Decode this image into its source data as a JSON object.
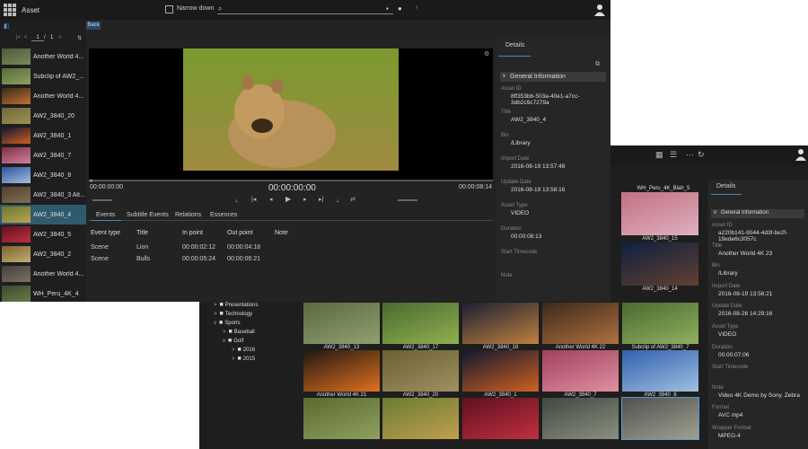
{
  "app_title": "Asset",
  "toolbar": {
    "narrow_down_label": "Narrow down"
  },
  "pager": {
    "first": "|<",
    "prev": "<",
    "page": "1",
    "of": "/",
    "total": "1",
    "next": ">",
    "sort": "⇅"
  },
  "back_label": "Back",
  "asset_list": [
    {
      "label": "Another World 4...",
      "c1": "#4a5a3a",
      "c2": "#7a8a5a"
    },
    {
      "label": "Subclip of AW2_...",
      "c1": "#556b3a",
      "c2": "#90a060"
    },
    {
      "label": "Another World 4...",
      "c1": "#3a2a1a",
      "c2": "#c07030"
    },
    {
      "label": "AW2_3840_20",
      "c1": "#6a6a3a",
      "c2": "#a09050"
    },
    {
      "label": "AW2_3840_1",
      "c1": "#101830",
      "c2": "#d06020"
    },
    {
      "label": "AW2_3840_7",
      "c1": "#803040",
      "c2": "#d080a0"
    },
    {
      "label": "AW2_3840_8",
      "c1": "#3050a0",
      "c2": "#a0c0e0"
    },
    {
      "label": "AW2_3840_3 Alt...",
      "c1": "#504030",
      "c2": "#807050"
    },
    {
      "label": "AW2_3840_4",
      "c1": "#6a7a30",
      "c2": "#c0a050"
    },
    {
      "label": "AW2_3840_5",
      "c1": "#601020",
      "c2": "#c03040"
    },
    {
      "label": "AW2_3840_2",
      "c1": "#806030",
      "c2": "#c0b070"
    },
    {
      "label": "Another World 4...",
      "c1": "#404040",
      "c2": "#807060"
    },
    {
      "label": "WH_Peru_4K_4",
      "c1": "#3a4a2a",
      "c2": "#6a7a4a"
    }
  ],
  "player": {
    "time_left": "00:00:00:00",
    "time_center": "00:00:00:00",
    "time_right": "00:00:08:14"
  },
  "tabs": [
    "Events",
    "Subtitle Events",
    "Relations",
    "Essences"
  ],
  "events_table": {
    "headers": [
      "Event type",
      "Title",
      "In point",
      "Out point",
      "Note"
    ],
    "rows": [
      [
        "Scene",
        "Lion",
        "00:00:02:12",
        "00:00:04:18",
        ""
      ],
      [
        "Scene",
        "Bulls",
        "00:00:05:24",
        "00:00:06:21",
        ""
      ]
    ]
  },
  "details_front": {
    "tab": "Details",
    "section": "General Information",
    "fields": [
      {
        "label": "Asset ID",
        "value": "8ff353bb-503a-40e1-a7cc-3db2c9c7279a"
      },
      {
        "label": "Title",
        "value": "AW2_3840_4"
      },
      {
        "label": "Bin",
        "value": "/Library"
      },
      {
        "label": "Import Date",
        "value": "2016-08-19 13:57:48"
      },
      {
        "label": "Update Date",
        "value": "2016-08-19 13:58:16"
      },
      {
        "label": "Asset Type",
        "value": "VIDEO"
      },
      {
        "label": "Duration",
        "value": "00:00:08:13"
      },
      {
        "label": "Start Timecode",
        "value": ""
      },
      {
        "label": "Note",
        "value": ""
      }
    ]
  },
  "details_back": {
    "tab": "Details",
    "section": "General Information",
    "fields": [
      {
        "label": "Asset ID",
        "value": "a220b141-9044-4d3f-be2f-19ede6c3057c"
      },
      {
        "label": "Title",
        "value": "Another World 4K 23"
      },
      {
        "label": "Bin",
        "value": "/Library"
      },
      {
        "label": "Import Date",
        "value": "2016-08-19 13:56:21"
      },
      {
        "label": "Update Date",
        "value": "2016-08-26 14:29:16"
      },
      {
        "label": "Asset Type",
        "value": "VIDEO"
      },
      {
        "label": "Duration",
        "value": "00:00:07:06"
      },
      {
        "label": "Start Timecode",
        "value": ""
      },
      {
        "label": "Note",
        "value": "Video 4K Demo by Sony. Zebra"
      },
      {
        "label": "Format",
        "value": "AVC mp4"
      },
      {
        "label": "Wrapper Format",
        "value": "MPEG-4"
      }
    ]
  },
  "tree": [
    {
      "label": "Presentations",
      "indent": 0,
      "arrow": ">"
    },
    {
      "label": "Technology",
      "indent": 0,
      "arrow": ">"
    },
    {
      "label": "Sports",
      "indent": 0,
      "arrow": "v"
    },
    {
      "label": "Baseball",
      "indent": 1,
      "arrow": ">"
    },
    {
      "label": "Golf",
      "indent": 1,
      "arrow": "v"
    },
    {
      "label": "2016",
      "indent": 2,
      "arrow": ">"
    },
    {
      "label": "2015",
      "indent": 2,
      "arrow": ">"
    }
  ],
  "grid_right_col": [
    {
      "label": "AW2_3840_15",
      "c1": "#c07080",
      "c2": "#e0b0c0"
    },
    {
      "label": "AW2_3840_14",
      "c1": "#102040",
      "c2": "#604030"
    }
  ],
  "grid_partial_label": "WH_Peru_4K_Blah_5",
  "grid": [
    [
      {
        "label": "AW2_3840_13",
        "c1": "#5a6a40",
        "c2": "#90a070"
      },
      {
        "label": "AW2_3840_17",
        "c1": "#4a6a30",
        "c2": "#90b050"
      },
      {
        "label": "AW2_3840_18",
        "c1": "#1a2030",
        "c2": "#c08040"
      },
      {
        "label": "Another World 4K 22",
        "c1": "#3a2a1a",
        "c2": "#b07040"
      },
      {
        "label": "Subclip of AW2_3840_7",
        "c1": "#4a6a30",
        "c2": "#90b060"
      }
    ],
    [
      {
        "label": "Another World 4K 21",
        "c1": "#201810",
        "c2": "#e07020"
      },
      {
        "label": "AW2_3840_20",
        "c1": "#6a6030",
        "c2": "#a09060"
      },
      {
        "label": "AW2_3840_1",
        "c1": "#101830",
        "c2": "#d06020"
      },
      {
        "label": "AW2_3840_7",
        "c1": "#a04060",
        "c2": "#e090a0"
      },
      {
        "label": "AW2_3840_8",
        "c1": "#3060b0",
        "c2": "#a0c0e0"
      }
    ],
    [
      {
        "label": "",
        "c1": "#5a6a30",
        "c2": "#90a060"
      },
      {
        "label": "",
        "c1": "#6a7a30",
        "c2": "#c0a050"
      },
      {
        "label": "",
        "c1": "#601020",
        "c2": "#c03040"
      },
      {
        "label": "",
        "c1": "#404840",
        "c2": "#8a9080"
      },
      {
        "label": "",
        "c1": "#505050",
        "c2": "#a0a090"
      }
    ]
  ]
}
